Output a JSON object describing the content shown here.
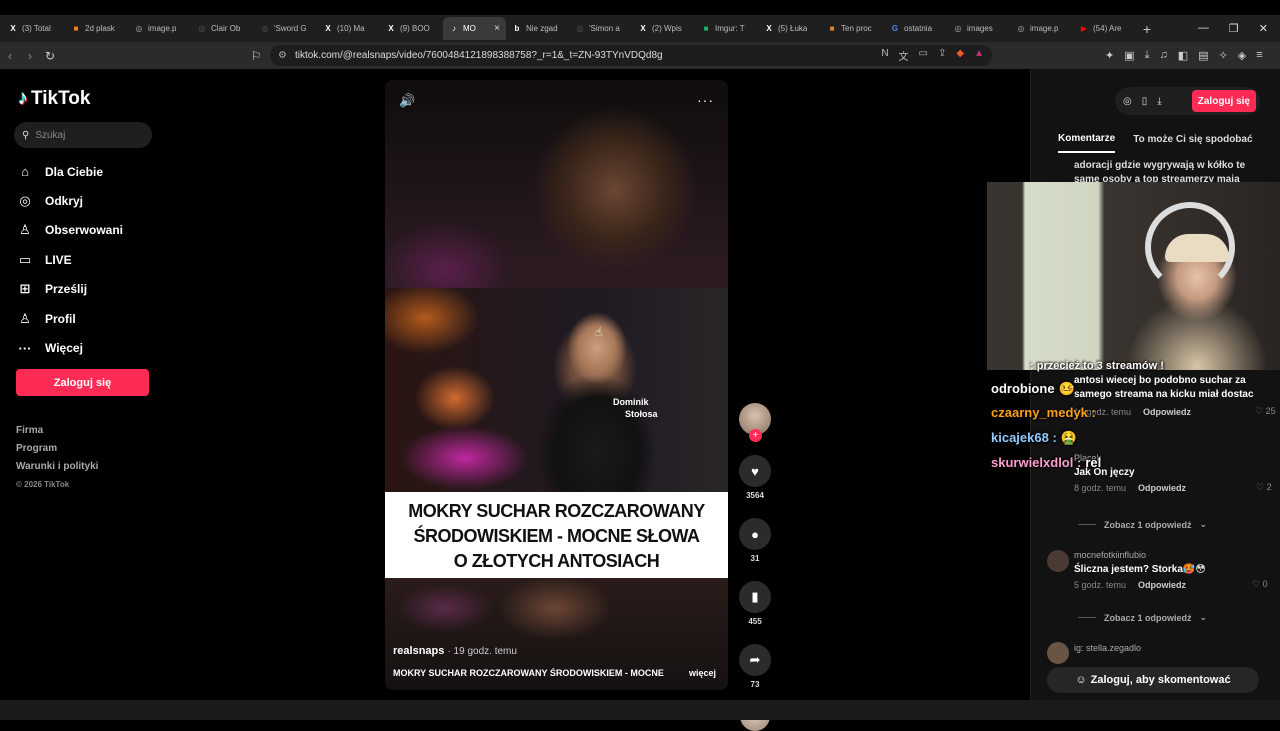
{
  "browser": {
    "tabs": [
      {
        "label": "(3) Total",
        "fav": "X",
        "fav_color": "#ffffff"
      },
      {
        "label": "2d plask",
        "fav": "■",
        "fav_color": "#f58220"
      },
      {
        "label": "image.p",
        "fav": "◎",
        "fav_color": "#aaaaaa"
      },
      {
        "label": "Clair Ob",
        "fav": "◎",
        "fav_color": "#555555"
      },
      {
        "label": "'Sword G",
        "fav": "◎",
        "fav_color": "#555555"
      },
      {
        "label": "(10) Ma",
        "fav": "X",
        "fav_color": "#ffffff"
      },
      {
        "label": "(9) BOO",
        "fav": "X",
        "fav_color": "#ffffff"
      },
      {
        "label": "MO",
        "fav": "♪",
        "fav_color": "#ffffff",
        "active": true
      },
      {
        "label": "Nie zgad",
        "fav": "b",
        "fav_color": "#ffffff"
      },
      {
        "label": "'Simon a",
        "fav": "◎",
        "fav_color": "#555555"
      },
      {
        "label": "(2) Wpis",
        "fav": "X",
        "fav_color": "#ffffff"
      },
      {
        "label": "Imgur: T",
        "fav": "■",
        "fav_color": "#1bb76e"
      },
      {
        "label": "(5) Łuka",
        "fav": "X",
        "fav_color": "#ffffff"
      },
      {
        "label": "Ten proc",
        "fav": "■",
        "fav_color": "#f58220"
      },
      {
        "label": "ostatnia",
        "fav": "G",
        "fav_color": "#4285f4"
      },
      {
        "label": "images",
        "fav": "◎",
        "fav_color": "#aaaaaa"
      },
      {
        "label": "image.p",
        "fav": "◎",
        "fav_color": "#aaaaaa"
      },
      {
        "label": "(54) Are",
        "fav": "▶",
        "fav_color": "#ff0000"
      }
    ],
    "url": "tiktok.com/@realsnaps/video/7600484121898388758?_r=1&_t=ZN-93TYnVDQd8g"
  },
  "sidebar": {
    "brand": "TikTok",
    "search_placeholder": "Szukaj",
    "nav": [
      {
        "label": "Dla Ciebie",
        "icon": "⌂",
        "name": "home"
      },
      {
        "label": "Odkryj",
        "icon": "◎",
        "name": "explore"
      },
      {
        "label": "Obserwowani",
        "icon": "♙",
        "name": "following"
      },
      {
        "label": "LIVE",
        "icon": "▭",
        "name": "live"
      },
      {
        "label": "Prześlij",
        "icon": "⊞",
        "name": "upload"
      },
      {
        "label": "Profil",
        "icon": "♙",
        "name": "profile"
      },
      {
        "label": "Więcej",
        "icon": "···",
        "name": "more"
      }
    ],
    "login": "Zaloguj się",
    "footer": [
      "Firma",
      "Program",
      "Warunki i polityki"
    ],
    "copyright": "© 2026 TikTok"
  },
  "video": {
    "name_line1": "Dominik",
    "name_line2": "Stołosa",
    "caption_lines": [
      "MOKRY SUCHAR ROZCZAROWANY",
      "ŚRODOWISKIEM - MOCNE SŁOWA",
      "O ZŁOTYCH ANTOSIACH"
    ],
    "author": "realsnaps",
    "time": "· 19 godz. temu",
    "desc": "MOKRY SUCHAR ROZCZAROWANY ŚRODOWISKIEM - MOCNE",
    "more": "więcej"
  },
  "actions": {
    "likes": "3564",
    "comments": "31",
    "saves": "455",
    "shares": "73"
  },
  "right": {
    "login": "Zaloguj się",
    "tab_comments": "Komentarze",
    "tab_related": "To może Ci się spodobać",
    "frag1": "adoracji gdzie wygrywają w kółko te",
    "frag2": "same osoby a top streamerzy mają",
    "c1_text1": "antosi wiecej bo podobno suchar za",
    "c1_text2": "samego streama na kicku miał dostac",
    "c1_time": "19 godz. temu",
    "c1_reply": "Odpowiedz",
    "c1_likes": "25",
    "c2_user": "Placek",
    "c2_text": "Jak On jęczy",
    "c2_time": "8 godz. temu",
    "c2_reply": "Odpowiedz",
    "c2_likes": "2",
    "see1": "Zobacz 1 odpowiedź",
    "c3_user": "mocnefotkiinflubio",
    "c3_text": "Śliczna jestem? Storka🥵😳",
    "c3_time": "5 godz. temu",
    "c3_reply": "Odpowiedz",
    "c3_likes": "0",
    "see2": "Zobacz 1 odpowiedź",
    "c4_user": "ig: stella.zegadlo",
    "comment_btn": "Zaloguj, aby skomentować"
  },
  "overlay_chat": [
    {
      "user": "odrobione",
      "msg": "🤒",
      "color": "#ffffff"
    },
    {
      "user": "czaarny_medyk :",
      "msg": "",
      "color": "#ff9f1a"
    },
    {
      "user": "kicajek68 :",
      "msg": "🤮",
      "color": "#8ecbff"
    },
    {
      "user": "skurwielxdlol :",
      "msg": "rel",
      "color": "#ff9ecb"
    },
    {
      "user": ": przecież to 3 streamów !",
      "msg": "",
      "color": "#ffffff"
    }
  ]
}
